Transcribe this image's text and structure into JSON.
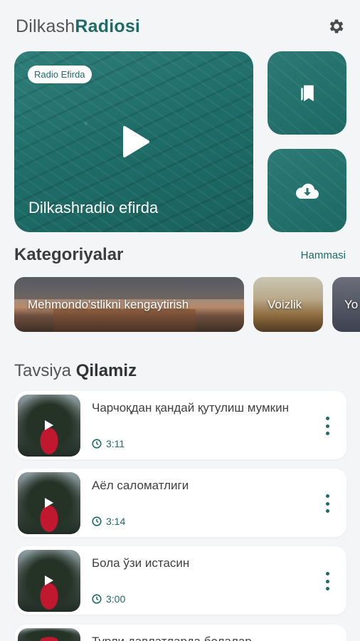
{
  "header": {
    "brand_part1": "Dilkash",
    "brand_part2": "Radiosi",
    "settings_icon": "gear-icon"
  },
  "hero": {
    "badge": "Radio Efirda",
    "title": "Dilkashradio efirda",
    "play_icon": "play-icon"
  },
  "side_tiles": [
    {
      "icon": "bookmarks-icon"
    },
    {
      "icon": "cloud-download-icon"
    }
  ],
  "categories": {
    "title": "Kategoriyalar",
    "see_all": "Hammasi",
    "items": [
      {
        "label": "Mehmondo'stlikni kengaytirish"
      },
      {
        "label": "Voizlik"
      },
      {
        "label": "Yo"
      }
    ]
  },
  "recommend": {
    "title_part1": "Tavsiya",
    "title_part2": "Qilamiz",
    "items": [
      {
        "title": "Чарчоқдан қандай қутулиш мумкин",
        "duration": "3:11"
      },
      {
        "title": "Аёл саломатлиги",
        "duration": "3:14"
      },
      {
        "title": "Бола ўзи истасин",
        "duration": "3:00"
      },
      {
        "title": "Турли давлатларда болалар",
        "duration": ""
      }
    ]
  },
  "colors": {
    "accent": "#1e6b67",
    "background": "#f4f5f7"
  }
}
